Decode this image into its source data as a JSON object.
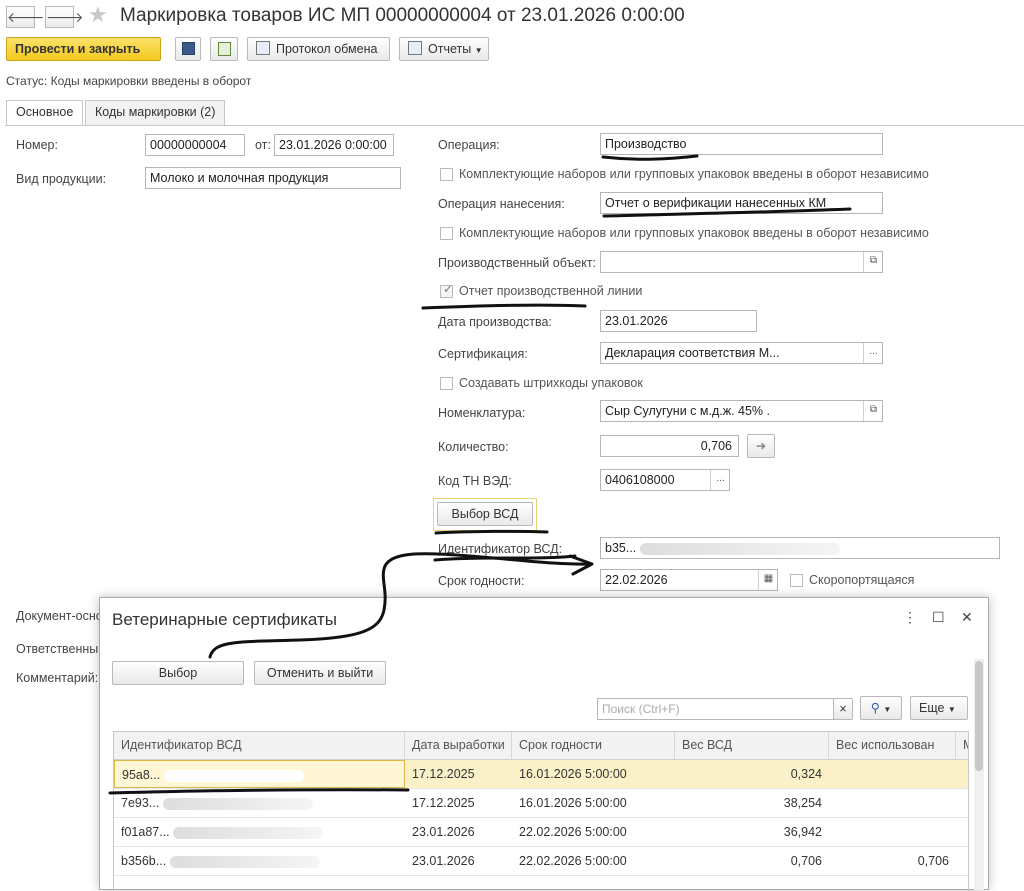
{
  "window": {
    "title": "Маркировка товаров ИС МП 00000000004 от 23.01.2026 0:00:00",
    "nav_back": "🡐",
    "nav_forward": "🡒",
    "star": "★"
  },
  "toolbar": {
    "post_close": "Провести и закрыть",
    "exchange_log": "Протокол обмена",
    "reports": "Отчеты"
  },
  "status": "Статус: Коды маркировки введены в оборот",
  "tabs": [
    {
      "label": "Основное"
    },
    {
      "label": "Коды маркировки (2)"
    }
  ],
  "form": {
    "number_label": "Номер:",
    "number": "00000000004",
    "from_label": "от:",
    "date": "23.01.2026  0:00:00",
    "product_kind_label": "Вид продукции:",
    "product_kind": "Молоко и молочная продукция",
    "doc_basis_label": "Документ-осно",
    "responsible_label": "Ответственный",
    "comment_label": "Комментарий:",
    "operation_label": "Операция:",
    "operation": "Производство",
    "kit_checkbox": "Комплектующие наборов или групповых упаковок введены в оборот независимо",
    "apply_op_label": "Операция нанесения:",
    "apply_op": "Отчет о верификации нанесенных КМ",
    "kit_checkbox2": "Комплектующие наборов или групповых упаковок введены в оборот независимо",
    "prod_object_label": "Производственный объект:",
    "prod_object": "",
    "line_report": "Отчет производственной линии",
    "prod_date_label": "Дата производства:",
    "prod_date": "23.01.2026",
    "cert_label": "Сертификация:",
    "cert": "Декларация соответствия М...",
    "barcodes_checkbox": "Создавать штрихкоды упаковок",
    "nomenclature_label": "Номенклатура:",
    "nomenclature": "Сыр Сулугуни с м.д.ж. 45% .",
    "quantity_label": "Количество:",
    "quantity": "0,706",
    "tnved_label": "Код ТН ВЭД:",
    "tnved": "0406108000",
    "select_vsd": "Выбор ВСД",
    "vsd_id_label": "Идентификатор ВСД:",
    "vsd_id": "b35...",
    "expiry_label": "Срок годности:",
    "expiry": "22.02.2026",
    "perishable": "Скоропортящаяся"
  },
  "modal": {
    "title": "Ветеринарные сертификаты",
    "more_icon": "⋮",
    "maximize_icon": "☐",
    "close_icon": "✕",
    "select": "Выбор",
    "cancel": "Отменить и выйти",
    "search_placeholder": "Поиск (Ctrl+F)",
    "clear": "×",
    "more": "Еще",
    "columns": [
      "Идентификатор ВСД",
      "Дата выработки",
      "Срок годности",
      "Вес ВСД",
      "Вес использован",
      "М"
    ],
    "rows": [
      {
        "id": "95a8...",
        "made": "17.12.2025",
        "expiry": "16.01.2026 5:00:00",
        "weight": "0,324",
        "used": ""
      },
      {
        "id": "7e93...",
        "made": "17.12.2025",
        "expiry": "16.01.2026 5:00:00",
        "weight": "38,254",
        "used": ""
      },
      {
        "id": "f01a87...",
        "made": "23.01.2026",
        "expiry": "22.02.2026 5:00:00",
        "weight": "36,942",
        "used": ""
      },
      {
        "id": "b356b...",
        "made": "23.01.2026",
        "expiry": "22.02.2026 5:00:00",
        "weight": "0,706",
        "used": "0,706"
      }
    ]
  }
}
